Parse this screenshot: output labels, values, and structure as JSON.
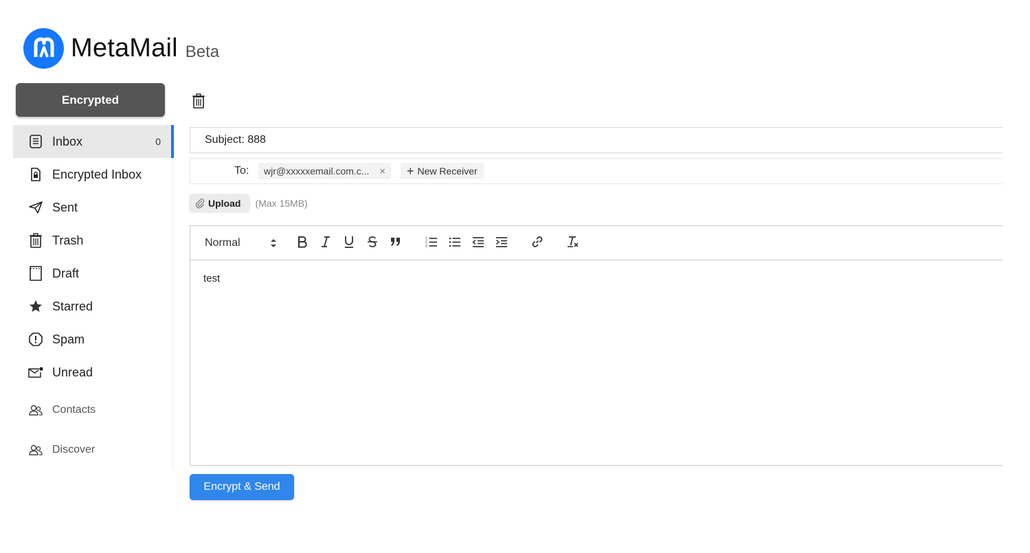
{
  "brand": {
    "name": "MetaMail",
    "tag": "Beta",
    "color": "#1677ff"
  },
  "sidebar": {
    "compose_label": "Encrypted",
    "items": [
      {
        "label": "Inbox",
        "count": "0",
        "icon": "inbox-icon",
        "active": true
      },
      {
        "label": "Encrypted Inbox",
        "icon": "lock-file-icon"
      },
      {
        "label": "Sent",
        "icon": "paper-plane-icon"
      },
      {
        "label": "Trash",
        "icon": "trash-icon"
      },
      {
        "label": "Draft",
        "icon": "draft-file-icon"
      },
      {
        "label": "Starred",
        "icon": "star-icon"
      },
      {
        "label": "Spam",
        "icon": "warning-shield-icon"
      },
      {
        "label": "Unread",
        "icon": "unread-mail-icon"
      },
      {
        "label": "Contacts",
        "icon": "contacts-icon"
      },
      {
        "label": "Discover",
        "icon": "discover-icon"
      }
    ],
    "accent": "#1677ff"
  },
  "compose": {
    "subject": "Subject: 888",
    "to_label": "To:",
    "recipients": [
      {
        "address": "wjr@xxxxxemail.com.c...",
        "remove": "×"
      }
    ],
    "new_receiver_label": "New Receiver",
    "upload_label": "Upload",
    "upload_hint": "(Max 15MB)",
    "editor": {
      "format_value": "Normal",
      "toolbar": [
        "bold",
        "italic",
        "underline",
        "strike",
        "blockquote",
        "ordered-list",
        "bullet-list",
        "outdent",
        "indent",
        "link",
        "clear-format"
      ],
      "body": "test"
    },
    "send_label": "Encrypt & Send",
    "send_color": "#2f86eb"
  }
}
